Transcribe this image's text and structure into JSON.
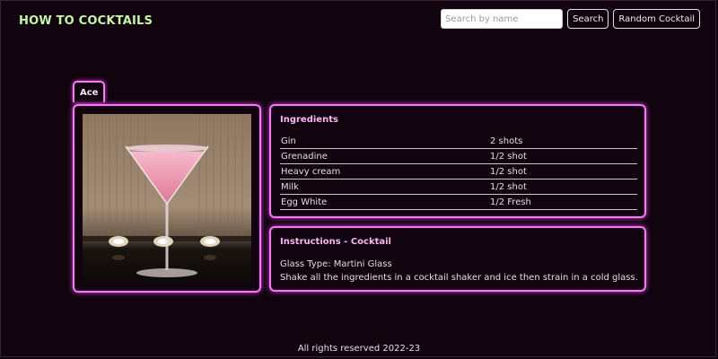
{
  "header": {
    "brand": "HOW TO COCKTAILS",
    "search_placeholder": "Search by name",
    "search_value": "",
    "search_button": "Search",
    "random_button": "Random Cocktail"
  },
  "drink": {
    "tab_label": "Ace",
    "photo_icon": "martini-glass-photo",
    "ingredients_title": "Ingredients",
    "ingredients": [
      {
        "name": "Gin",
        "measure": "2 shots"
      },
      {
        "name": "Grenadine",
        "measure": "1/2 shot"
      },
      {
        "name": "Heavy cream",
        "measure": "1/2 shot"
      },
      {
        "name": "Milk",
        "measure": "1/2 shot"
      },
      {
        "name": "Egg White",
        "measure": "1/2 Fresh"
      }
    ],
    "instructions_title": "Instructions - Cocktail",
    "glass_type": "Glass Type: Martini Glass",
    "instructions": "Shake all the ingredients in a cocktail shaker and ice then strain in a cold glass."
  },
  "footer": {
    "text": "All rights reserved 2022-23"
  },
  "colors": {
    "background": "#11040f",
    "neon": "#f27cf0",
    "brand": "#c6f5a8",
    "heading": "#f5b8f2"
  }
}
